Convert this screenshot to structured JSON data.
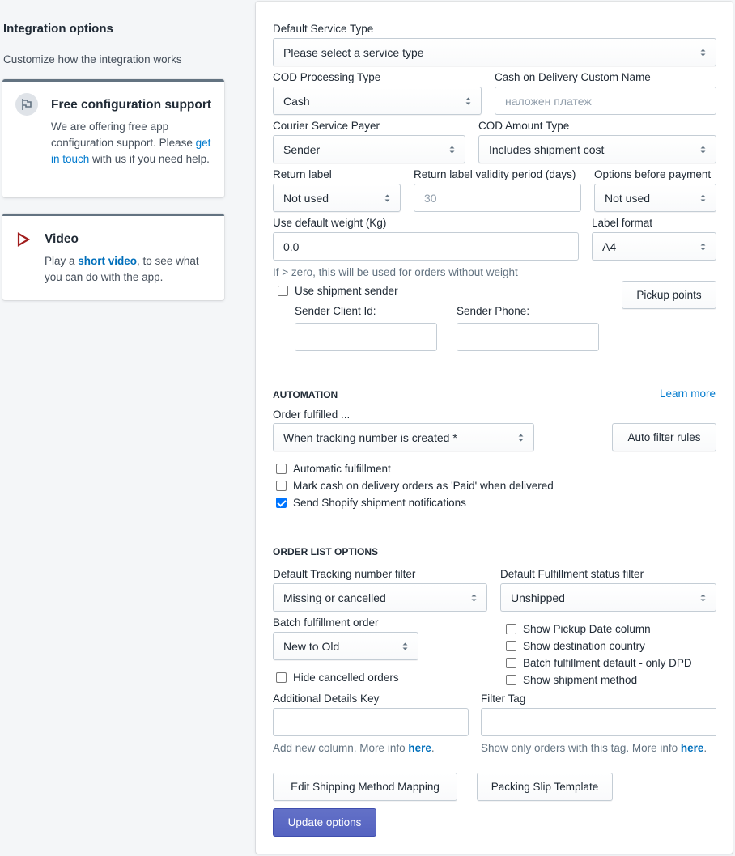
{
  "sidebar": {
    "title": "Integration options",
    "subtitle": "Customize how the integration works",
    "support_card": {
      "icon": "flag-icon",
      "heading": "Free configuration support",
      "text_before": "We are offering free app configuration support. Please ",
      "link": "get in touch",
      "text_after": " with us if you need help."
    },
    "video_card": {
      "icon": "play-icon",
      "heading": "Video",
      "text_before": "Play a ",
      "link": "short video",
      "text_after": ", to see what you can do with the app."
    }
  },
  "general": {
    "default_service_type": {
      "label": "Default Service Type",
      "value": "Please select a service type"
    },
    "cod_processing_type": {
      "label": "COD Processing Type",
      "value": "Cash"
    },
    "cod_custom_name": {
      "label": "Cash on Delivery Custom Name",
      "placeholder": "наложен платеж"
    },
    "courier_service_payer": {
      "label": "Courier Service Payer",
      "value": "Sender"
    },
    "cod_amount_type": {
      "label": "COD Amount Type",
      "value": "Includes shipment cost"
    },
    "return_label": {
      "label": "Return label",
      "value": "Not used"
    },
    "return_label_validity": {
      "label": "Return label validity period (days)",
      "placeholder": "30"
    },
    "options_before_payment": {
      "label": "Options before payment",
      "value": "Not used"
    },
    "default_weight": {
      "label": "Use default weight (Kg)",
      "value": "0.0",
      "hint": "If > zero, this will be used for orders without weight"
    },
    "label_format": {
      "label": "Label format",
      "value": "A4"
    },
    "use_shipment_sender": {
      "label": "Use shipment sender",
      "checked": false
    },
    "sender_client_id": {
      "label": "Sender Client Id:",
      "value": ""
    },
    "sender_phone": {
      "label": "Sender Phone:",
      "value": ""
    },
    "pickup_points_button": "Pickup points"
  },
  "automation": {
    "title": "AUTOMATION",
    "learn_more": "Learn more",
    "order_fulfilled": {
      "label": "Order fulfilled ...",
      "value": "When tracking number is created *"
    },
    "auto_filter_button": "Auto filter rules",
    "checkboxes": [
      {
        "label": "Automatic fulfillment",
        "checked": false
      },
      {
        "label": "Mark cash on delivery orders as 'Paid' when delivered",
        "checked": false
      },
      {
        "label": "Send Shopify shipment notifications",
        "checked": true
      }
    ]
  },
  "order_list": {
    "title": "ORDER LIST OPTIONS",
    "tracking_filter": {
      "label": "Default Tracking number filter",
      "value": "Missing or cancelled"
    },
    "fulfillment_filter": {
      "label": "Default Fulfillment status filter",
      "value": "Unshipped"
    },
    "batch_order": {
      "label": "Batch fulfillment order",
      "value": "New to Old"
    },
    "hide_cancelled": {
      "label": "Hide cancelled orders",
      "checked": false
    },
    "right_checkboxes": [
      {
        "label": "Show Pickup Date column",
        "checked": false
      },
      {
        "label": "Show destination country",
        "checked": false
      },
      {
        "label": "Batch fulfillment default - only DPD",
        "checked": false
      },
      {
        "label": "Show shipment method",
        "checked": false
      }
    ],
    "additional_details_key": {
      "label": "Additional Details Key",
      "value": "",
      "hint": "Add new column. More info ",
      "hint_link": "here"
    },
    "filter_tag": {
      "label": "Filter Tag",
      "value": "",
      "hint": "Show only orders with this tag. More info ",
      "hint_link": "here"
    },
    "edit_mapping_button": "Edit Shipping Method Mapping",
    "packing_slip_button": "Packing Slip Template",
    "update_button": "Update options"
  }
}
